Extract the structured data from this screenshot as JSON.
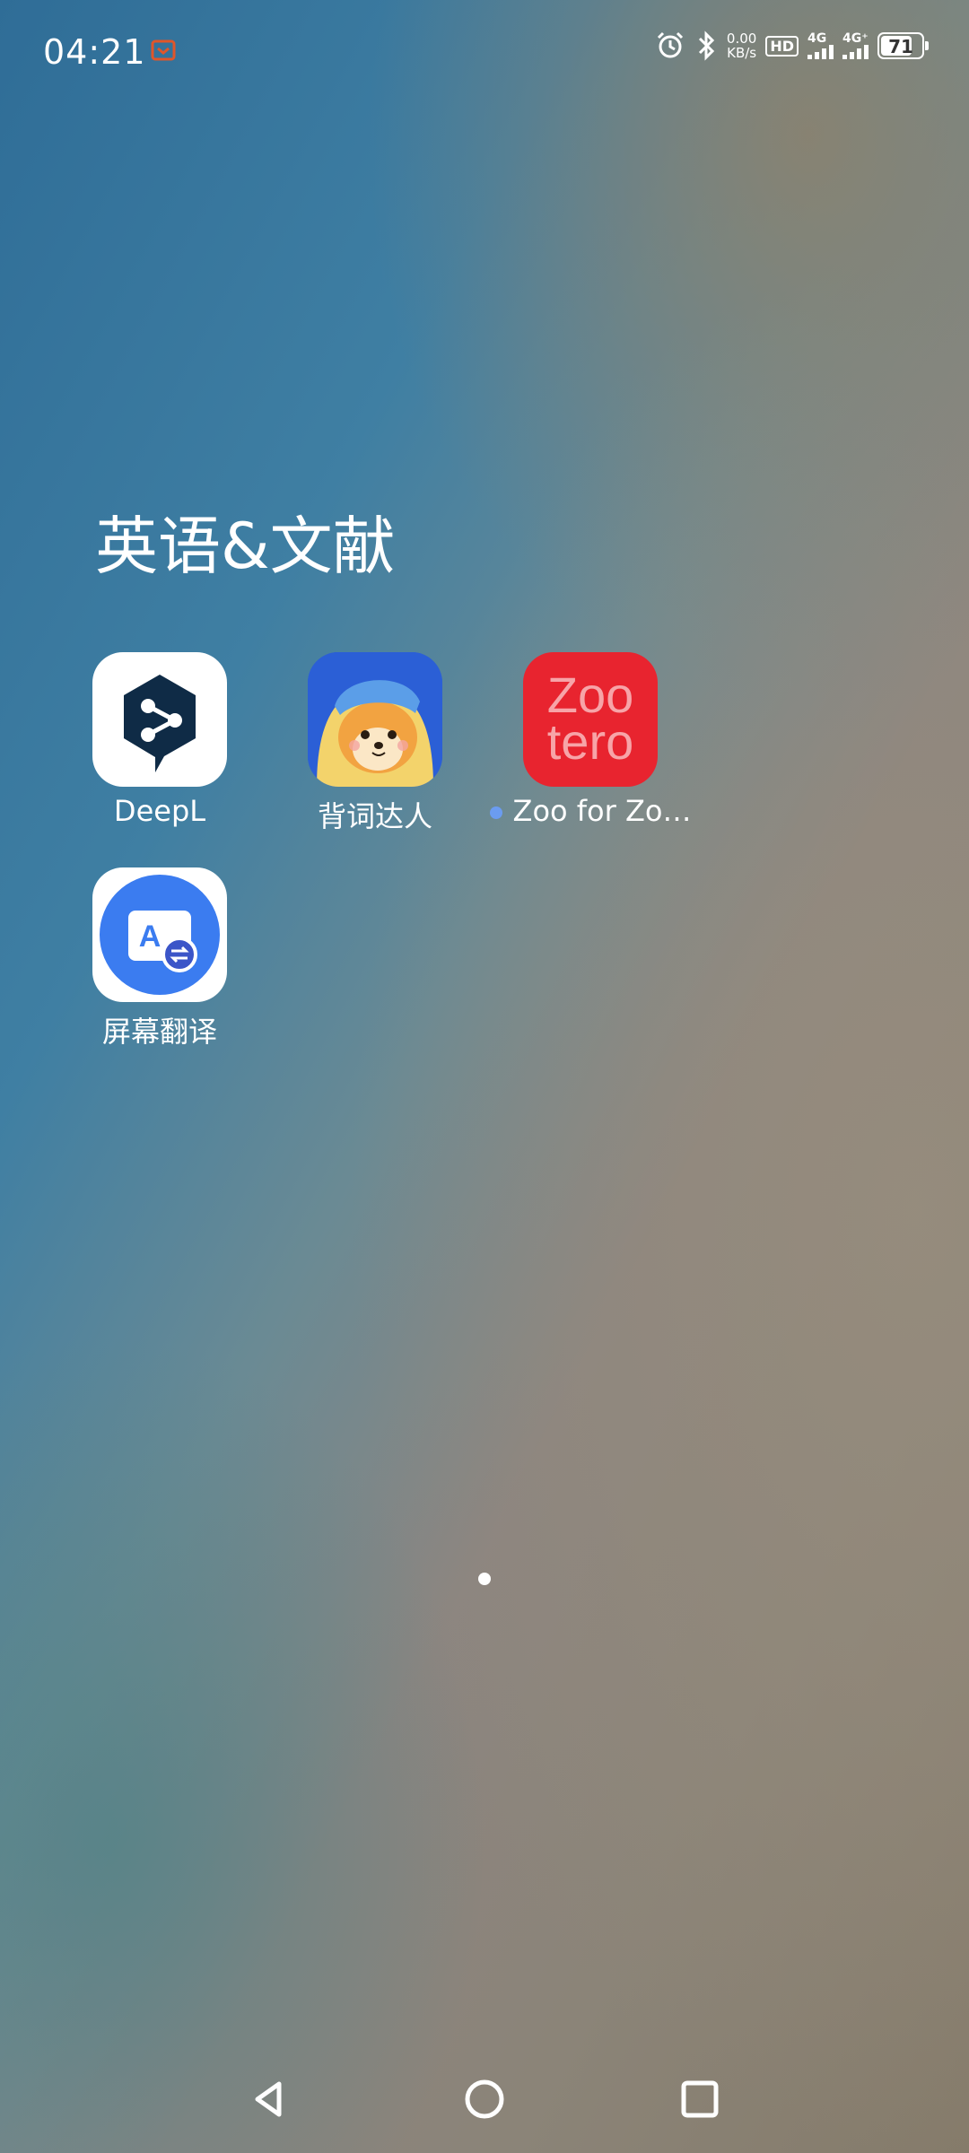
{
  "status_bar": {
    "time": "04:21",
    "net_speed_value": "0.00",
    "net_speed_unit": "KB/s",
    "hd_label": "HD",
    "sim1_gen": "4G",
    "sim2_gen": "4G⁺",
    "battery_level": "71",
    "icons": [
      "notification-icon",
      "alarm-icon",
      "bluetooth-icon"
    ]
  },
  "folder": {
    "title": "英语&文献"
  },
  "apps": [
    {
      "label": "DeepL",
      "icon": "deepl-icon"
    },
    {
      "label": "背词达人",
      "icon": "beicidaren-icon"
    },
    {
      "label": "Zoo for Zo…",
      "icon": "zotero-icon",
      "icon_text_line1": "Zoo",
      "icon_text_line2": "tero",
      "has_new_dot": true
    },
    {
      "label": "屏幕翻译",
      "icon": "screen-translate-icon",
      "icon_letter": "A"
    }
  ],
  "navigation": {
    "buttons": [
      "back",
      "home",
      "recents"
    ]
  },
  "colors": {
    "zotero_red": "#e8242f",
    "deepl_navy": "#0f2b46",
    "translate_blue": "#3b7cf0",
    "new_dot": "#6b9cf0"
  }
}
